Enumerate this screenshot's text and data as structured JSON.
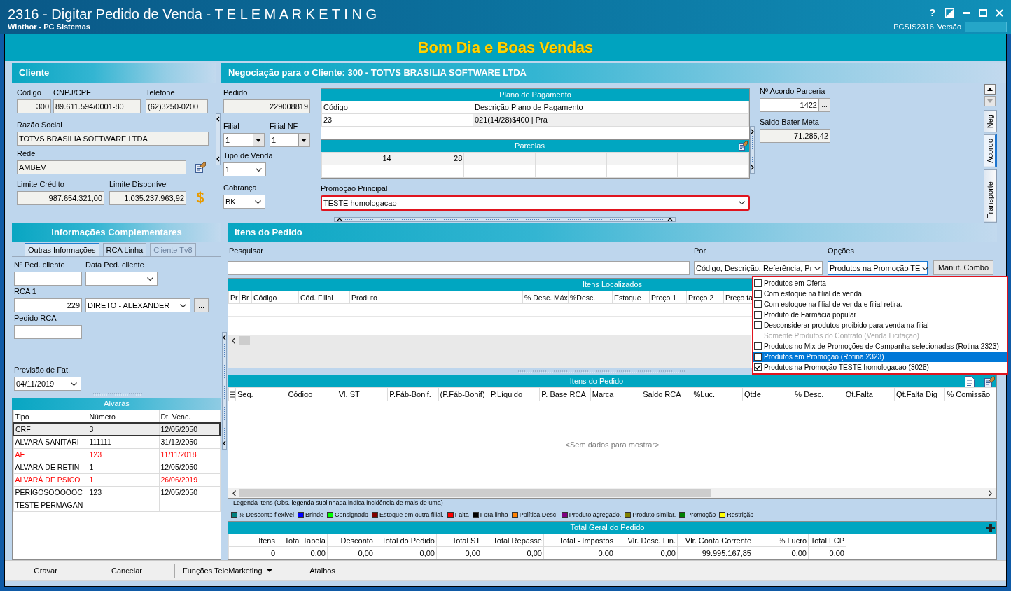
{
  "window": {
    "title": "2316 - Digitar Pedido de Venda - T E L E M A R K E T I N G",
    "subtitle": "Winthor - PC Sistemas",
    "help_button": "?",
    "program_code": "PCSIS2316",
    "version_label": "Versão"
  },
  "banner": "Bom Dia e Boas Vendas",
  "cliente": {
    "title": "Cliente",
    "codigo": {
      "label": "Código",
      "value": "300"
    },
    "cnpj": {
      "label": "CNPJ/CPF",
      "value": "89.611.594/0001-80"
    },
    "telefone": {
      "label": "Telefone",
      "value": "(62)3250-0200"
    },
    "razao_social": {
      "label": "Razão Social",
      "value": "TOTVS BRASILIA SOFTWARE LTDA"
    },
    "rede": {
      "label": "Rede",
      "value": "AMBEV"
    },
    "limite_credito": {
      "label": "Limite Crédito",
      "value": "987.654.321,00"
    },
    "limite_disponivel": {
      "label": "Limite Disponível",
      "value": "1.035.237.963,92"
    }
  },
  "negociacao": {
    "title": "Negociação para o Cliente: 300 - TOTVS BRASILIA SOFTWARE LTDA",
    "pedido": {
      "label": "Pedido",
      "value": "229008819"
    },
    "filial": {
      "label": "Filial",
      "value": "1"
    },
    "filial_nf": {
      "label": "Filial NF",
      "value": "1"
    },
    "tipo_venda": {
      "label": "Tipo de Venda",
      "value": "1"
    },
    "cobranca": {
      "label": "Cobrança",
      "value": "BK"
    },
    "plano_pagamento": {
      "title": "Plano de Pagamento",
      "columns": [
        "Código",
        "Descrição Plano de Pagamento"
      ],
      "rows": [
        [
          "23",
          "021(14/28)$400 | Pra"
        ]
      ]
    },
    "parcelas": {
      "title": "Parcelas",
      "values": [
        "14",
        "28"
      ]
    },
    "promocao_principal": {
      "label": "Promoção Principal",
      "value": "TESTE homologacao",
      "highlighted": true
    },
    "acordo_parceria": {
      "label": "Nº Acordo Parceria",
      "value": "1422",
      "button": "..."
    },
    "saldo_meta": {
      "label": "Saldo Bater Meta",
      "value": "71.285,42"
    },
    "side_tabs": [
      {
        "label": "Neg",
        "selected": false
      },
      {
        "label": "Acordo",
        "selected": true
      },
      {
        "label": "Transporte",
        "selected": false
      }
    ]
  },
  "complementares": {
    "title": "Informações Complementares",
    "tabs": [
      {
        "label": "Outras Informações",
        "selected": true,
        "disabled": false
      },
      {
        "label": "RCA Linha",
        "selected": false,
        "disabled": false
      },
      {
        "label": "Cliente Tv8",
        "selected": false,
        "disabled": true
      }
    ],
    "ped_cliente": {
      "label": "Nº Ped. cliente"
    },
    "data_ped_cliente": {
      "label": "Data Ped. cliente"
    },
    "rca": {
      "label": "RCA 1",
      "code": "229",
      "name": "DIRETO - ALEXANDER",
      "button": "..."
    },
    "pedido_rca": {
      "label": "Pedido RCA"
    },
    "previsao_fat": {
      "label": "Previsão de Fat.",
      "value": "04/11/2019"
    },
    "alvaras": {
      "title": "Alvarás",
      "columns": [
        "Tipo",
        "Número",
        "Dt. Venc."
      ],
      "rows": [
        {
          "cells": [
            "CRF",
            "3",
            "12/05/2050"
          ],
          "selected": true,
          "color": "#000000"
        },
        {
          "cells": [
            "ALVARÁ SANITÁRI",
            "111111",
            "31/12/2050"
          ],
          "selected": false,
          "color": "#000000"
        },
        {
          "cells": [
            "AE",
            "123",
            "11/11/2018"
          ],
          "selected": false,
          "color": "#ff0000"
        },
        {
          "cells": [
            "ALVARÁ DE RETIN",
            "1",
            "12/05/2050"
          ],
          "selected": false,
          "color": "#000000"
        },
        {
          "cells": [
            "ALVARÁ DE PSICO",
            "1",
            "26/06/2019"
          ],
          "selected": false,
          "color": "#ff0000"
        },
        {
          "cells": [
            "PERIGOSOOOOOC",
            "123",
            "12/05/2050"
          ],
          "selected": false,
          "color": "#000000"
        },
        {
          "cells": [
            "TESTE PERMAGAN"
          ],
          "selected": false,
          "color": "#000000"
        }
      ]
    }
  },
  "itens": {
    "title": "Itens do Pedido",
    "pesquisar": {
      "label": "Pesquisar"
    },
    "por": {
      "label": "Por",
      "value": "Código, Descrição, Referência, Pr"
    },
    "opcoes": {
      "label": "Opções",
      "value": "Produtos na Promoção TE",
      "focused": true
    },
    "manut_button": "Manut. Combo",
    "opcoes_menu": {
      "highlighted": true,
      "items": [
        {
          "label": "Produtos em Oferta",
          "checked": false,
          "selected": false,
          "disabled": false
        },
        {
          "label": "Com estoque na filial de venda.",
          "checked": false,
          "selected": false,
          "disabled": false
        },
        {
          "label": "Com estoque na filial de venda e filial retira.",
          "checked": false,
          "selected": false,
          "disabled": false
        },
        {
          "label": "Produto de Farmácia popular",
          "checked": false,
          "selected": false,
          "disabled": false
        },
        {
          "label": "Desconsiderar produtos proibido para venda na filial",
          "checked": false,
          "selected": false,
          "disabled": false
        },
        {
          "label": "Somente Produtos do Contrato (Venda Licitação)",
          "selected": false,
          "disabled": true
        },
        {
          "label": "Produtos no Mix de Promoções de Campanha selecionadas (Rotina 2323)",
          "checked": false,
          "selected": false,
          "disabled": false
        },
        {
          "label": "Produtos em Promoção (Rotina 2323)",
          "checked": false,
          "selected": true,
          "disabled": false
        },
        {
          "label": "Produtos na Promoção TESTE homologacao (3028)",
          "checked": true,
          "selected": false,
          "disabled": false
        }
      ]
    },
    "localizados": {
      "title": "Itens Localizados",
      "columns": [
        "Pr",
        "Br",
        "Código",
        "Cód. Filial",
        "Produto",
        "% Desc. Máx",
        "%Desc.",
        "Estoque",
        "Preço 1",
        "Preço 2",
        "Preço ta"
      ]
    },
    "pedido_grid": {
      "title": "Itens do Pedido",
      "columns": [
        "Seq.",
        "Código",
        "Vl. ST",
        "P.Fáb-Bonif.",
        "(P.Fáb-Bonif)",
        "P.Líquido",
        "P. Base RCA",
        "Marca",
        "Saldo RCA",
        "%Luc.",
        "Qtde",
        "% Desc.",
        "Qt.Falta",
        "Qt.Falta Dig",
        "% Comissão"
      ],
      "empty_text": "<Sem dados para mostrar>"
    },
    "legenda": {
      "title": "Legenda itens (Obs. legenda sublinhada indica incidência de mais de uma)",
      "items": [
        {
          "label": "% Desconto flexível",
          "color": "#008080"
        },
        {
          "label": "Brinde",
          "color": "#0000ff"
        },
        {
          "label": "Consignado",
          "color": "#00ff00"
        },
        {
          "label": "Estoque em outra filial.",
          "color": "#800000"
        },
        {
          "label": "Falta",
          "color": "#ff0000"
        },
        {
          "label": "Fora linha",
          "color": "#000000"
        },
        {
          "label": "Política Desc.",
          "color": "#ff8000"
        },
        {
          "label": "Produto agregado.",
          "color": "#800080"
        },
        {
          "label": "Produto similar.",
          "color": "#808000"
        },
        {
          "label": "Promoção",
          "color": "#008000"
        },
        {
          "label": "Restrição",
          "color": "#ffff00"
        }
      ]
    },
    "totais": {
      "title": "Total Geral do Pedido",
      "columns": [
        "Itens",
        "Total Tabela",
        "Desconto",
        "Total do Pedido",
        "Total ST",
        "Total Repasse",
        "Total - Impostos",
        "Vlr. Desc. Fin.",
        "Vlr. Conta Corrente",
        "% Lucro",
        "Total FCP"
      ],
      "values": [
        "0",
        "0,00",
        "0,00",
        "0,00",
        "0,00",
        "0,00",
        "0,00",
        "0,00",
        "99.995.167,85",
        "0,00",
        "0,00"
      ]
    }
  },
  "footer": [
    {
      "label": "Gravar",
      "kind": "button"
    },
    {
      "label": "Cancelar",
      "kind": "button"
    },
    {
      "label": "Funções TeleMarketing",
      "kind": "menu"
    },
    {
      "label": "Atalhos",
      "kind": "button"
    }
  ]
}
